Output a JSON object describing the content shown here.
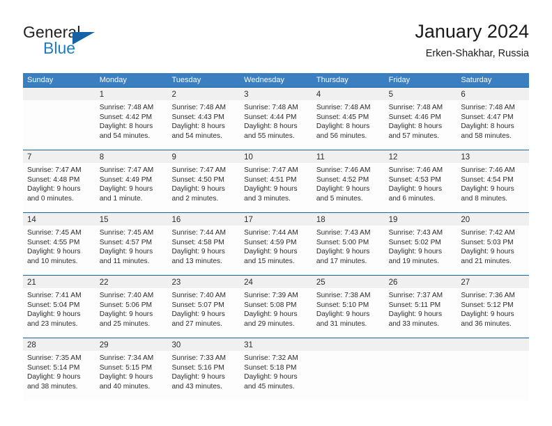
{
  "brand": {
    "general": "General",
    "blue": "Blue",
    "triangle_color": "#1463a5",
    "blue_color": "#1d7dc4"
  },
  "header": {
    "title": "January 2024",
    "subtitle": "Erken-Shakhar, Russia"
  },
  "theme": {
    "header_bar": "#3c7fc0",
    "row_rule": "#1463a5",
    "day_band": "#f0f0f0",
    "text": "#2b2b2b"
  },
  "weekday_headers": [
    "Sunday",
    "Monday",
    "Tuesday",
    "Wednesday",
    "Thursday",
    "Friday",
    "Saturday"
  ],
  "weeks": [
    [
      {
        "day": "",
        "empty": true
      },
      {
        "day": "1",
        "sunrise": "Sunrise: 7:48 AM",
        "sunset": "Sunset: 4:42 PM",
        "daylight1": "Daylight: 8 hours",
        "daylight2": "and 54 minutes."
      },
      {
        "day": "2",
        "sunrise": "Sunrise: 7:48 AM",
        "sunset": "Sunset: 4:43 PM",
        "daylight1": "Daylight: 8 hours",
        "daylight2": "and 54 minutes."
      },
      {
        "day": "3",
        "sunrise": "Sunrise: 7:48 AM",
        "sunset": "Sunset: 4:44 PM",
        "daylight1": "Daylight: 8 hours",
        "daylight2": "and 55 minutes."
      },
      {
        "day": "4",
        "sunrise": "Sunrise: 7:48 AM",
        "sunset": "Sunset: 4:45 PM",
        "daylight1": "Daylight: 8 hours",
        "daylight2": "and 56 minutes."
      },
      {
        "day": "5",
        "sunrise": "Sunrise: 7:48 AM",
        "sunset": "Sunset: 4:46 PM",
        "daylight1": "Daylight: 8 hours",
        "daylight2": "and 57 minutes."
      },
      {
        "day": "6",
        "sunrise": "Sunrise: 7:48 AM",
        "sunset": "Sunset: 4:47 PM",
        "daylight1": "Daylight: 8 hours",
        "daylight2": "and 58 minutes."
      }
    ],
    [
      {
        "day": "7",
        "sunrise": "Sunrise: 7:47 AM",
        "sunset": "Sunset: 4:48 PM",
        "daylight1": "Daylight: 9 hours",
        "daylight2": "and 0 minutes."
      },
      {
        "day": "8",
        "sunrise": "Sunrise: 7:47 AM",
        "sunset": "Sunset: 4:49 PM",
        "daylight1": "Daylight: 9 hours",
        "daylight2": "and 1 minute."
      },
      {
        "day": "9",
        "sunrise": "Sunrise: 7:47 AM",
        "sunset": "Sunset: 4:50 PM",
        "daylight1": "Daylight: 9 hours",
        "daylight2": "and 2 minutes."
      },
      {
        "day": "10",
        "sunrise": "Sunrise: 7:47 AM",
        "sunset": "Sunset: 4:51 PM",
        "daylight1": "Daylight: 9 hours",
        "daylight2": "and 3 minutes."
      },
      {
        "day": "11",
        "sunrise": "Sunrise: 7:46 AM",
        "sunset": "Sunset: 4:52 PM",
        "daylight1": "Daylight: 9 hours",
        "daylight2": "and 5 minutes."
      },
      {
        "day": "12",
        "sunrise": "Sunrise: 7:46 AM",
        "sunset": "Sunset: 4:53 PM",
        "daylight1": "Daylight: 9 hours",
        "daylight2": "and 6 minutes."
      },
      {
        "day": "13",
        "sunrise": "Sunrise: 7:46 AM",
        "sunset": "Sunset: 4:54 PM",
        "daylight1": "Daylight: 9 hours",
        "daylight2": "and 8 minutes."
      }
    ],
    [
      {
        "day": "14",
        "sunrise": "Sunrise: 7:45 AM",
        "sunset": "Sunset: 4:55 PM",
        "daylight1": "Daylight: 9 hours",
        "daylight2": "and 10 minutes."
      },
      {
        "day": "15",
        "sunrise": "Sunrise: 7:45 AM",
        "sunset": "Sunset: 4:57 PM",
        "daylight1": "Daylight: 9 hours",
        "daylight2": "and 11 minutes."
      },
      {
        "day": "16",
        "sunrise": "Sunrise: 7:44 AM",
        "sunset": "Sunset: 4:58 PM",
        "daylight1": "Daylight: 9 hours",
        "daylight2": "and 13 minutes."
      },
      {
        "day": "17",
        "sunrise": "Sunrise: 7:44 AM",
        "sunset": "Sunset: 4:59 PM",
        "daylight1": "Daylight: 9 hours",
        "daylight2": "and 15 minutes."
      },
      {
        "day": "18",
        "sunrise": "Sunrise: 7:43 AM",
        "sunset": "Sunset: 5:00 PM",
        "daylight1": "Daylight: 9 hours",
        "daylight2": "and 17 minutes."
      },
      {
        "day": "19",
        "sunrise": "Sunrise: 7:43 AM",
        "sunset": "Sunset: 5:02 PM",
        "daylight1": "Daylight: 9 hours",
        "daylight2": "and 19 minutes."
      },
      {
        "day": "20",
        "sunrise": "Sunrise: 7:42 AM",
        "sunset": "Sunset: 5:03 PM",
        "daylight1": "Daylight: 9 hours",
        "daylight2": "and 21 minutes."
      }
    ],
    [
      {
        "day": "21",
        "sunrise": "Sunrise: 7:41 AM",
        "sunset": "Sunset: 5:04 PM",
        "daylight1": "Daylight: 9 hours",
        "daylight2": "and 23 minutes."
      },
      {
        "day": "22",
        "sunrise": "Sunrise: 7:40 AM",
        "sunset": "Sunset: 5:06 PM",
        "daylight1": "Daylight: 9 hours",
        "daylight2": "and 25 minutes."
      },
      {
        "day": "23",
        "sunrise": "Sunrise: 7:40 AM",
        "sunset": "Sunset: 5:07 PM",
        "daylight1": "Daylight: 9 hours",
        "daylight2": "and 27 minutes."
      },
      {
        "day": "24",
        "sunrise": "Sunrise: 7:39 AM",
        "sunset": "Sunset: 5:08 PM",
        "daylight1": "Daylight: 9 hours",
        "daylight2": "and 29 minutes."
      },
      {
        "day": "25",
        "sunrise": "Sunrise: 7:38 AM",
        "sunset": "Sunset: 5:10 PM",
        "daylight1": "Daylight: 9 hours",
        "daylight2": "and 31 minutes."
      },
      {
        "day": "26",
        "sunrise": "Sunrise: 7:37 AM",
        "sunset": "Sunset: 5:11 PM",
        "daylight1": "Daylight: 9 hours",
        "daylight2": "and 33 minutes."
      },
      {
        "day": "27",
        "sunrise": "Sunrise: 7:36 AM",
        "sunset": "Sunset: 5:12 PM",
        "daylight1": "Daylight: 9 hours",
        "daylight2": "and 36 minutes."
      }
    ],
    [
      {
        "day": "28",
        "sunrise": "Sunrise: 7:35 AM",
        "sunset": "Sunset: 5:14 PM",
        "daylight1": "Daylight: 9 hours",
        "daylight2": "and 38 minutes."
      },
      {
        "day": "29",
        "sunrise": "Sunrise: 7:34 AM",
        "sunset": "Sunset: 5:15 PM",
        "daylight1": "Daylight: 9 hours",
        "daylight2": "and 40 minutes."
      },
      {
        "day": "30",
        "sunrise": "Sunrise: 7:33 AM",
        "sunset": "Sunset: 5:16 PM",
        "daylight1": "Daylight: 9 hours",
        "daylight2": "and 43 minutes."
      },
      {
        "day": "31",
        "sunrise": "Sunrise: 7:32 AM",
        "sunset": "Sunset: 5:18 PM",
        "daylight1": "Daylight: 9 hours",
        "daylight2": "and 45 minutes."
      },
      {
        "day": "",
        "empty": true
      },
      {
        "day": "",
        "empty": true
      },
      {
        "day": "",
        "empty": true
      }
    ]
  ]
}
